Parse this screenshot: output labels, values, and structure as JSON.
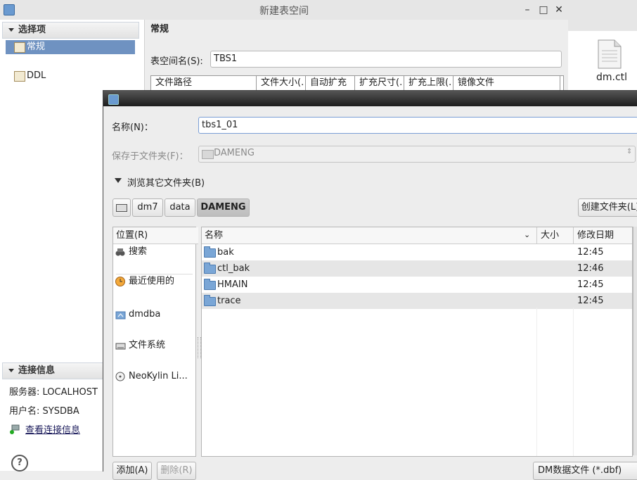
{
  "parent_dialog": {
    "title": "新建表空间",
    "sidebar": {
      "section_title": "选择项",
      "items": [
        {
          "label": "常规",
          "selected": true
        },
        {
          "label": "DDL",
          "selected": false
        }
      ],
      "connection_section_title": "连接信息",
      "server": "服务器: LOCALHOST",
      "user": "用户名: SYSDBA",
      "view_connection_link": "查看连接信息",
      "help": "?"
    },
    "main": {
      "section_title": "常规",
      "tablespace_label": "表空间名(S):",
      "tablespace_value": "TBS1",
      "columns": [
        "文件路径",
        "文件大小(.",
        "自动扩充",
        "扩充尺寸(.",
        "扩充上限(.",
        "镜像文件"
      ]
    }
  },
  "desktop": {
    "file_name": "dm.ctl"
  },
  "file_dialog": {
    "name_label": "名称(N)：",
    "name_value": "tbs1_01",
    "save_in_label": "保存于文件夹(F)：",
    "save_in_value": "DAMENG",
    "browse_label": "浏览其它文件夹(B)",
    "path_buttons": [
      "dm7",
      "data",
      "DAMENG"
    ],
    "create_folder": "创建文件夹(L)",
    "places_header": "位置(R)",
    "places": [
      {
        "label": "搜索",
        "icon": "search-icon"
      },
      {
        "label": "最近使用的",
        "icon": "recent-icon"
      },
      {
        "label": "dmdba",
        "icon": "home-folder-icon"
      },
      {
        "label": "文件系统",
        "icon": "drive-icon"
      },
      {
        "label": "NeoKylin Li...",
        "icon": "disc-icon"
      }
    ],
    "files_header": {
      "name": "名称",
      "size": "大小",
      "modified": "修改日期"
    },
    "files": [
      {
        "name": "bak",
        "size": "",
        "modified": "12:45"
      },
      {
        "name": "ctl_bak",
        "size": "",
        "modified": "12:46"
      },
      {
        "name": "HMAIN",
        "size": "",
        "modified": "12:45"
      },
      {
        "name": "trace",
        "size": "",
        "modified": "12:45"
      }
    ],
    "add_button": "添加(A)",
    "remove_button": "删除(R)",
    "filter_value": "DM数据文件 (*.dbf)"
  }
}
